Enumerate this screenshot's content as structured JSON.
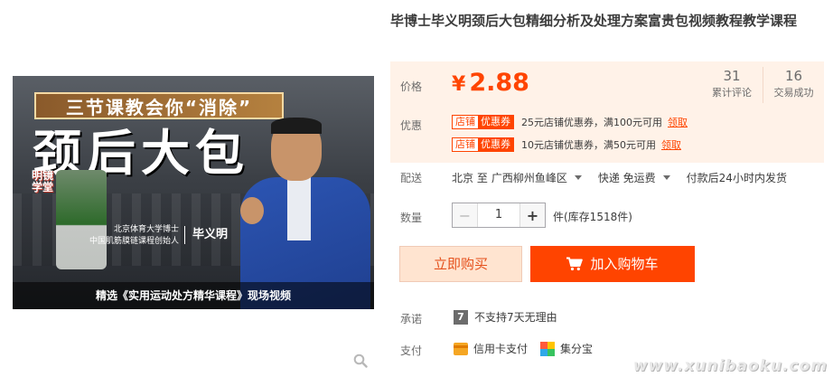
{
  "product": {
    "title": "毕博士毕义明颈后大包精细分析及处理方案富贵包视频教程教学课程"
  },
  "image": {
    "banner": "三节课教会你“消除”",
    "headline": "颈后大包",
    "vertical_sign": "明镜学堂",
    "caption_line1": "北京体育大学博士",
    "caption_line2": "中国肌筋膜链课程创始人",
    "presenter_name": "毕义明",
    "bottom_caption": "精选《实用运动处方精华课程》现场视频"
  },
  "price": {
    "label": "价格",
    "currency": "¥",
    "value": "2.88",
    "accent_color": "#ff4400"
  },
  "stats": [
    {
      "value": "31",
      "label": "累计评论"
    },
    {
      "value": "16",
      "label": "交易成功"
    }
  ],
  "promo": {
    "label": "优惠",
    "coupons": [
      {
        "tag_left": "店铺",
        "tag_right": "优惠券",
        "text": "25元店铺优惠券，满100元可用",
        "claim": "领取"
      },
      {
        "tag_left": "店铺",
        "tag_right": "优惠券",
        "text": "10元店铺优惠券，满50元可用",
        "claim": "领取"
      }
    ]
  },
  "shipping": {
    "label": "配送",
    "from": "北京 至",
    "to": "广西柳州鱼峰区",
    "method": "快递 免运费",
    "dispatch": "付款后24小时内发货"
  },
  "quantity": {
    "label": "数量",
    "value": "1",
    "minus": "−",
    "plus": "+",
    "stock": "件(库存1518件)"
  },
  "actions": {
    "buy_now": "立即购买",
    "add_to_cart": "加入购物车"
  },
  "promise": {
    "label": "承诺",
    "badge": "7",
    "text": "不支持7天无理由"
  },
  "payment": {
    "label": "支付",
    "methods": [
      "信用卡支付",
      "集分宝"
    ]
  },
  "watermark": "www.xunibaoku.com"
}
